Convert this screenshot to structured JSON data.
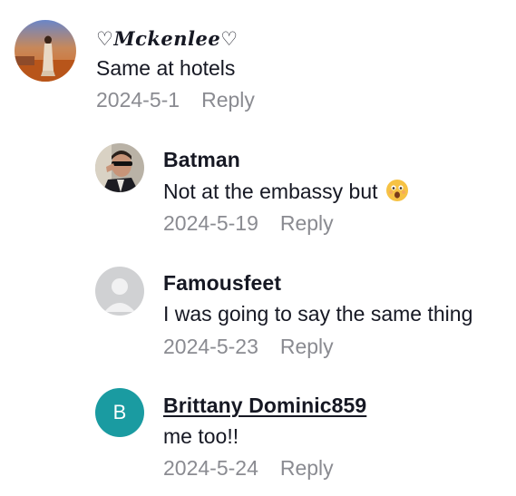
{
  "comments": [
    {
      "username": "♡𝑴𝒄𝒌𝒆𝒏𝒍𝒆𝒆♡",
      "text": "Same at hotels",
      "date": "2024-5-1",
      "reply_label": "Reply",
      "avatar_type": "photo-sunset-figure"
    },
    {
      "username": "Batman",
      "text": "Not at the embassy but",
      "emoji": "hushed-face-emoji",
      "date": "2024-5-19",
      "reply_label": "Reply",
      "avatar_type": "photo-man-sunglasses"
    },
    {
      "username": "Famousfeet",
      "text": "I was going to say the same thing",
      "date": "2024-5-23",
      "reply_label": "Reply",
      "avatar_type": "default-person"
    },
    {
      "username": "Brittany Dominic859",
      "text": "me too!!",
      "date": "2024-5-24",
      "reply_label": "Reply",
      "avatar_type": "letter",
      "avatar_letter": "B",
      "avatar_color": "#1a9ba1"
    }
  ],
  "colors": {
    "text_primary": "#161823",
    "text_secondary": "#8a8b91",
    "letter_avatar_bg": "#1a9ba1"
  }
}
